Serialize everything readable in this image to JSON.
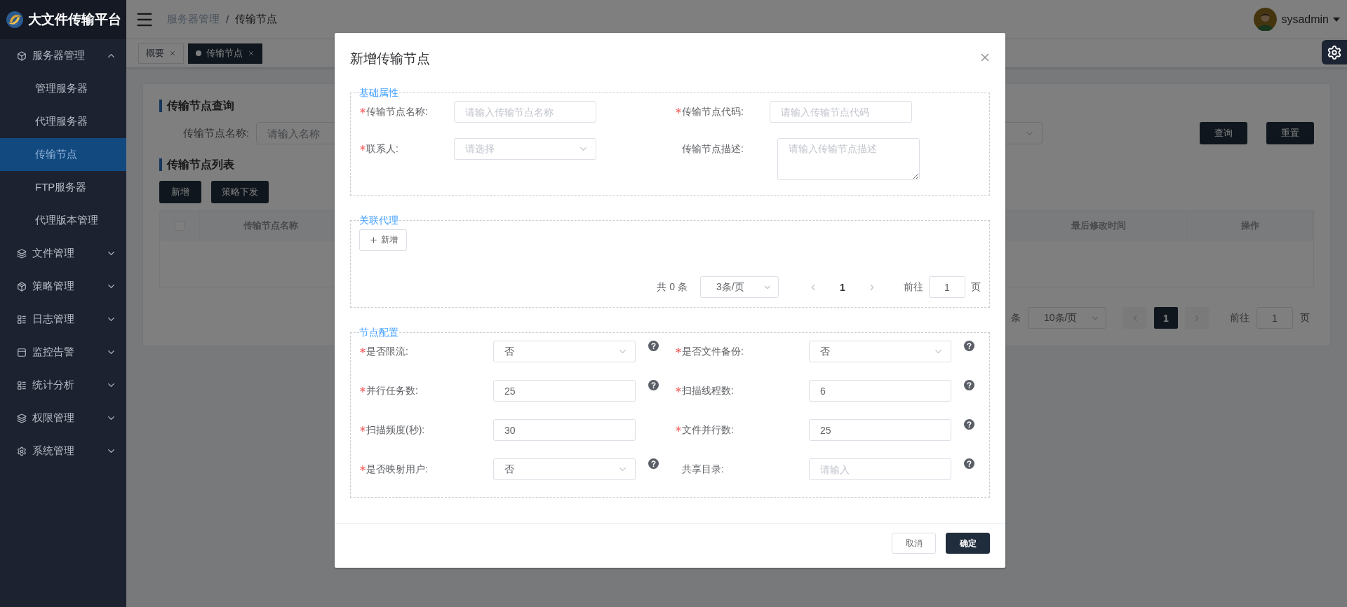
{
  "app": {
    "title": "大文件传输平台"
  },
  "header": {
    "breadcrumb": [
      "服务器管理",
      "传输节点"
    ],
    "separator": "/",
    "user": "sysadmin"
  },
  "sidebar": {
    "items": [
      {
        "label": "服务器管理",
        "expanded": true,
        "children": [
          {
            "label": "管理服务器",
            "selected": false
          },
          {
            "label": "代理服务器",
            "selected": false
          },
          {
            "label": "传输节点",
            "selected": true
          },
          {
            "label": "FTP服务器",
            "selected": false
          },
          {
            "label": "代理版本管理",
            "selected": false
          }
        ]
      },
      {
        "label": "文件管理",
        "expanded": false
      },
      {
        "label": "策略管理",
        "expanded": false
      },
      {
        "label": "日志管理",
        "expanded": false
      },
      {
        "label": "监控告警",
        "expanded": false
      },
      {
        "label": "统计分析",
        "expanded": false
      },
      {
        "label": "权限管理",
        "expanded": false
      },
      {
        "label": "系统管理",
        "expanded": false
      }
    ]
  },
  "tabs": [
    {
      "label": "概要",
      "selected": false
    },
    {
      "label": "传输节点",
      "selected": true
    }
  ],
  "query": {
    "title": "传输节点查询",
    "label": "传输节点名称:",
    "placeholder": "请输入名称",
    "buttons": [
      "查询",
      "重置"
    ]
  },
  "list": {
    "title": "传输节点列表",
    "buttons": [
      "新增",
      "策略下发"
    ],
    "select_all": {
      "checked": false
    },
    "columns": [
      "传输节点名称",
      "最后修改时间",
      "操作"
    ],
    "pagination": {
      "total": "条",
      "page_size": "10条/页",
      "pages": [
        {
          "label": "1",
          "selected": true
        }
      ],
      "goto": "前往",
      "goto_value": "1",
      "suffix": "页"
    }
  },
  "dialog": {
    "title": "新增传输节点",
    "sections": [
      {
        "kind": "attributes",
        "legend": "基础属性",
        "fields": [
          {
            "kind": "input",
            "label": "传输节点名称:",
            "required": true,
            "placeholder": "请输入传输节点名称",
            "help": false
          },
          {
            "kind": "input",
            "label": "传输节点代码:",
            "required": true,
            "placeholder": "请输入传输节点代码",
            "help": false
          },
          {
            "kind": "select",
            "label": "联系人:",
            "required": true,
            "placeholder": "请选择",
            "help": false
          },
          {
            "kind": "textarea",
            "label": "传输节点描述:",
            "required": false,
            "placeholder": "请输入传输节点描述",
            "help": false
          }
        ]
      },
      {
        "kind": "proxy",
        "legend": "关联代理",
        "add_button": "新增",
        "pagination": {
          "total": "共 0 条",
          "page_size": "3条/页",
          "pages": [
            {
              "label": "1",
              "selected": true
            }
          ],
          "goto": "前往",
          "goto_value": "1",
          "suffix": "页"
        }
      },
      {
        "kind": "config",
        "legend": "节点配置",
        "fields": [
          {
            "kind": "select",
            "label": "是否限流:",
            "required": true,
            "value": "否",
            "help": true
          },
          {
            "kind": "select",
            "label": "是否文件备份:",
            "required": true,
            "value": "否",
            "help": true
          },
          {
            "kind": "input",
            "label": "并行任务数:",
            "required": true,
            "value": "25",
            "help": true
          },
          {
            "kind": "input",
            "label": "扫描线程数:",
            "required": true,
            "value": "6",
            "help": true
          },
          {
            "kind": "input",
            "label": "扫描频度(秒):",
            "required": true,
            "value": "30",
            "help": false
          },
          {
            "kind": "input",
            "label": "文件并行数:",
            "required": true,
            "value": "25",
            "help": true
          },
          {
            "kind": "select",
            "label": "是否映射用户:",
            "required": true,
            "value": "否",
            "help": true
          },
          {
            "kind": "input",
            "label": "共享目录:",
            "required": false,
            "placeholder": "请输入",
            "help": true
          }
        ]
      }
    ],
    "buttons": [
      {
        "label": "取消",
        "primary": false
      },
      {
        "label": "确定",
        "primary": true
      }
    ]
  }
}
